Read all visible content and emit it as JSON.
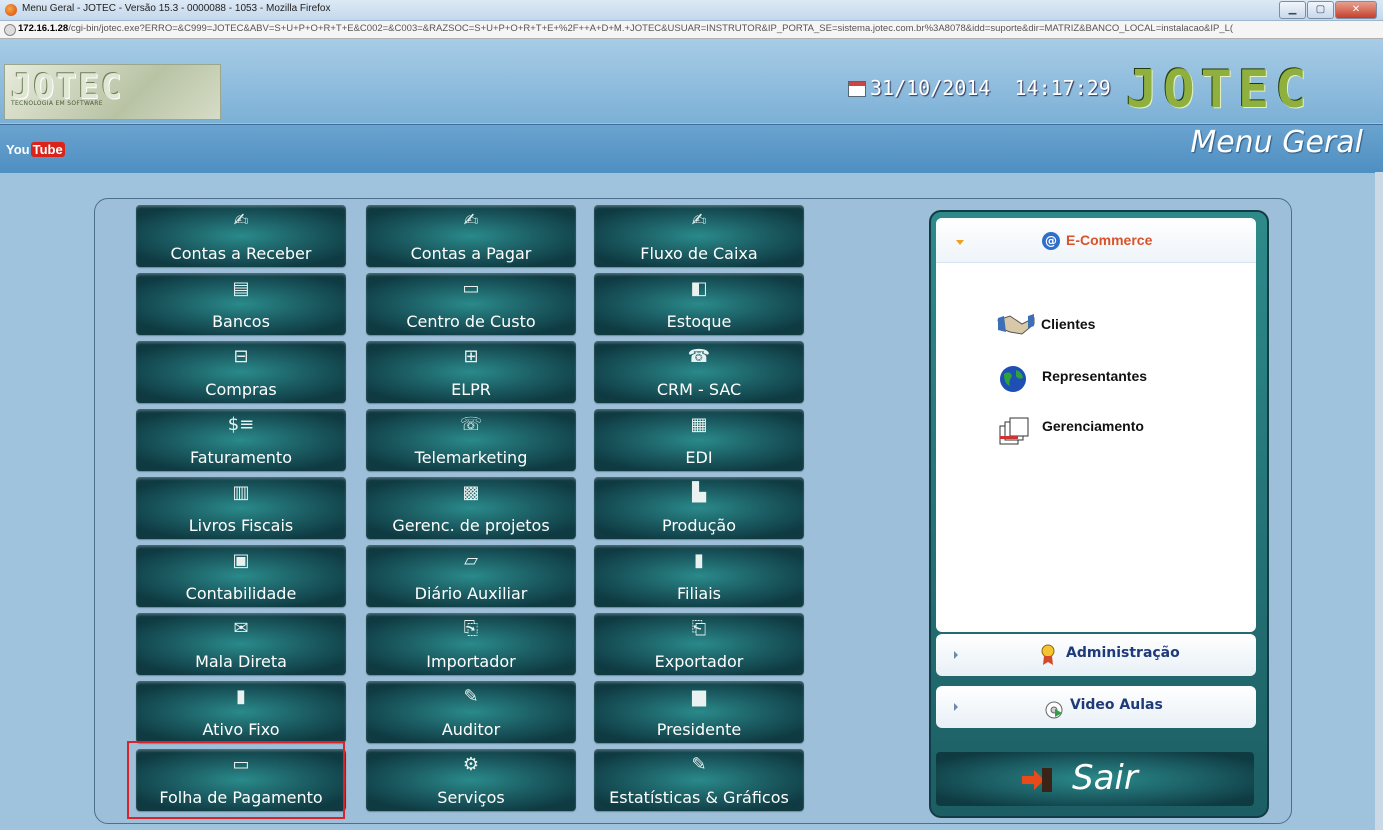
{
  "window": {
    "title": "Menu Geral - JOTEC - Versão 15.3 - 0000088 - 1053 - Mozilla Firefox",
    "url_host": "172.16.1.28",
    "url_path": "/cgi-bin/jotec.exe?ERRO=&C999=JOTEC&ABV=S+U+P+O+R+T+E&C002=&C003=&RAZSOC=S+U+P+O+R+T+E+%2F++A+D+M.+JOTEC&USUAR=INSTRUTOR&IP_PORTA_SE=sistema.jotec.com.br%3A8078&idd=suporte&dir=MATRIZ&BANCO_LOCAL=instalacao&IP_L("
  },
  "header": {
    "logo_text": "JOTEC",
    "logo_sub": "TECNOLOGIA EM SOFTWARE",
    "date": "31/10/2014",
    "time": "14:17:29",
    "brand": "JOTEC",
    "youtube_you": "You",
    "youtube_tube": "Tube",
    "page_title": "Menu Geral"
  },
  "modules": [
    {
      "label": "Contas a Receber",
      "icon": "✍"
    },
    {
      "label": "Contas a Pagar",
      "icon": "✍"
    },
    {
      "label": "Fluxo de Caixa",
      "icon": "✍"
    },
    {
      "label": "Bancos",
      "icon": "▤"
    },
    {
      "label": "Centro de Custo",
      "icon": "▭"
    },
    {
      "label": "Estoque",
      "icon": "◧"
    },
    {
      "label": "Compras",
      "icon": "⊟"
    },
    {
      "label": "ELPR",
      "icon": "⊞"
    },
    {
      "label": "CRM - SAC",
      "icon": "☎"
    },
    {
      "label": "Faturamento",
      "icon": "$≡"
    },
    {
      "label": "Telemarketing",
      "icon": "☏"
    },
    {
      "label": "EDI",
      "icon": "▦"
    },
    {
      "label": "Livros Fiscais",
      "icon": "▥"
    },
    {
      "label": "Gerenc. de projetos",
      "icon": "▩"
    },
    {
      "label": "Produção",
      "icon": "▙"
    },
    {
      "label": "Contabilidade",
      "icon": "▣"
    },
    {
      "label": "Diário Auxiliar",
      "icon": "▱"
    },
    {
      "label": "Filiais",
      "icon": "▮"
    },
    {
      "label": "Mala Direta",
      "icon": "✉"
    },
    {
      "label": "Importador",
      "icon": "⎘"
    },
    {
      "label": "Exportador",
      "icon": "⎗"
    },
    {
      "label": "Ativo Fixo",
      "icon": "▮"
    },
    {
      "label": "Auditor",
      "icon": "✎"
    },
    {
      "label": "Presidente",
      "icon": "▆"
    },
    {
      "label": "Folha de Pagamento",
      "icon": "▭"
    },
    {
      "label": "Serviços",
      "icon": "⚙"
    },
    {
      "label": "Estatísticas & Gráficos",
      "icon": "✎"
    }
  ],
  "sidebar": {
    "ecommerce": {
      "title": "E-Commerce",
      "items": [
        "Clientes",
        "Representantes",
        "Gerenciamento"
      ]
    },
    "administracao": "Administração",
    "video_aulas": "Video Aulas",
    "sair": "Sair"
  },
  "colors": {
    "button_teal": "#1b5c62",
    "highlight_red": "#d8232a",
    "ecommerce_title": "#d9532a",
    "section_title": "#1f3a7a"
  }
}
